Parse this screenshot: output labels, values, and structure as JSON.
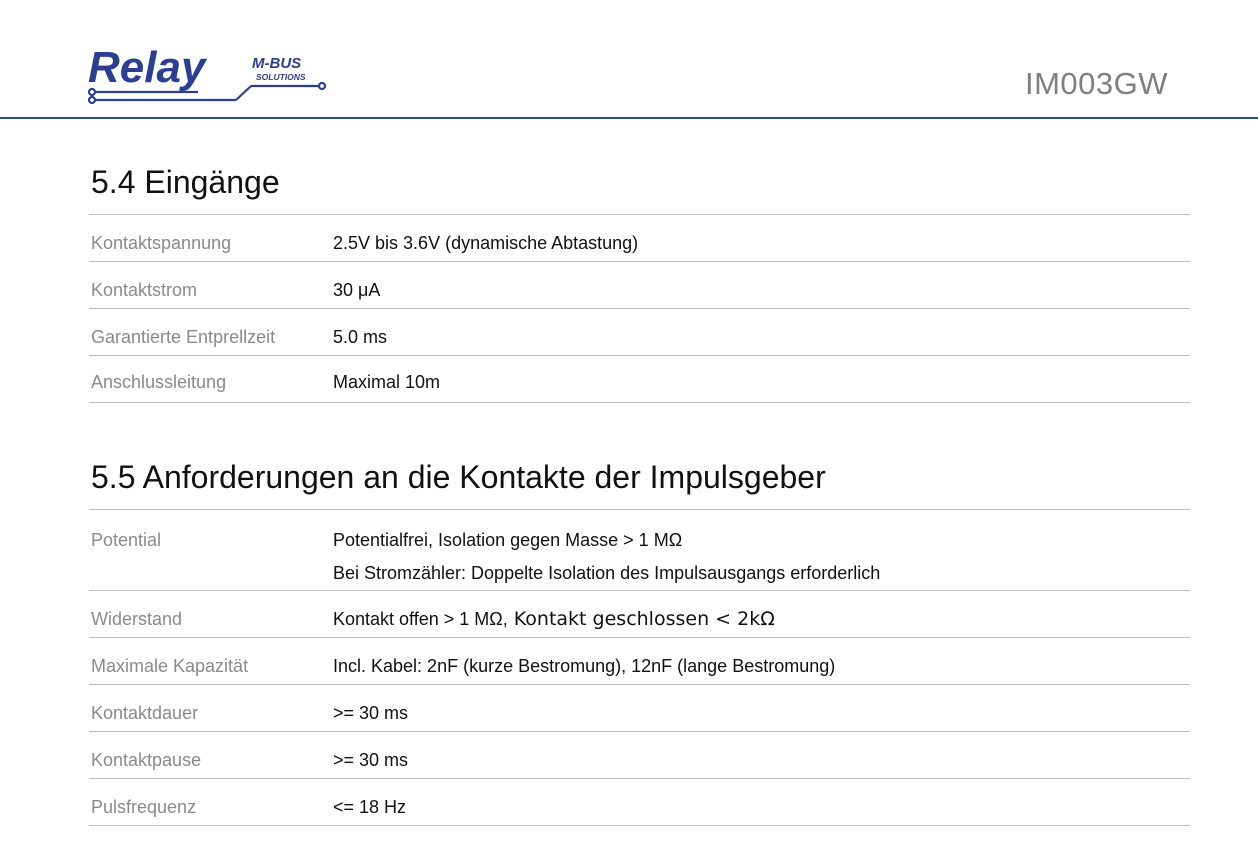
{
  "header": {
    "logo": {
      "brand": "Relay",
      "tag_top": "M-BUS",
      "tag_bottom": "SOLUTIONS",
      "color": "#2b3e91"
    },
    "doc_code": "IM003GW",
    "rule_color": "#2e4a8f"
  },
  "sections": [
    {
      "title": "5.4 Eingänge",
      "rows": [
        {
          "label": "Kontaktspannung",
          "value": "2.5V bis 3.6V (dynamische Abtastung)"
        },
        {
          "label": "Kontaktstrom",
          "value": "30 μA"
        },
        {
          "label": "Garantierte Entprellzeit",
          "value": "5.0 ms"
        },
        {
          "label": "Anschlussleitung",
          "value": "Maximal 10m"
        }
      ]
    },
    {
      "title": "5.5 Anforderungen an die Kontakte der Impulsgeber",
      "rows": [
        {
          "label": "Potential",
          "value": "Potentialfrei, Isolation gegen Masse > 1 MΩ",
          "value2": "Bei Stromzähler: Doppelte Isolation des Impulsausgangs erforderlich"
        },
        {
          "label": "Widerstand",
          "value": "Kontakt offen > 1 MΩ,",
          "value_b": " Kontakt geschlossen < 2kΩ"
        },
        {
          "label": "Maximale Kapazität",
          "value": "Incl. Kabel: 2nF (kurze Bestromung), 12nF (lange Bestromung)"
        },
        {
          "label": "Kontaktdauer",
          "value": ">= 30 ms"
        },
        {
          "label": "Kontaktpause",
          "value": ">= 30 ms"
        },
        {
          "label": "Pulsfrequenz",
          "value": "<= 18 Hz"
        }
      ]
    }
  ]
}
